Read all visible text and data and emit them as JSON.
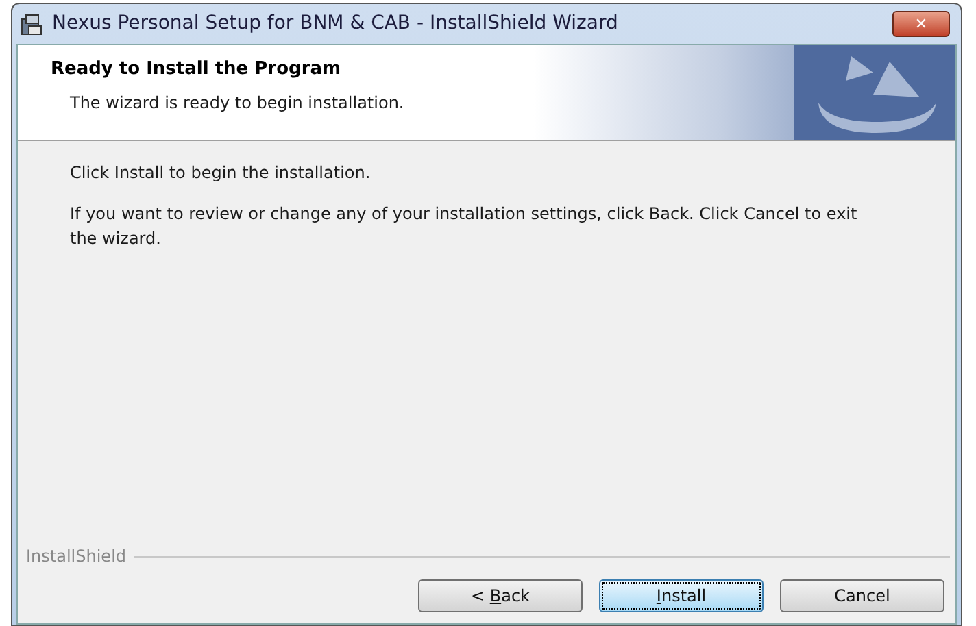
{
  "window": {
    "title": "Nexus Personal Setup for BNM & CAB - InstallShield Wizard",
    "close_label": "✕"
  },
  "banner": {
    "title": "Ready to Install the Program",
    "subtitle": "The wizard is ready to begin installation."
  },
  "body": [
    "Click Install to begin the installation.",
    "If you want to review or change any of your installation settings, click Back. Click Cancel to exit the wizard."
  ],
  "footer": {
    "brand": "InstallShield"
  },
  "buttons": [
    {
      "before": "< ",
      "accelerator": "B",
      "after": "ack",
      "focused": false
    },
    {
      "accelerator": "I",
      "after": "nstall",
      "focused": true
    },
    {
      "before": "Cancel",
      "focused": false
    }
  ]
}
